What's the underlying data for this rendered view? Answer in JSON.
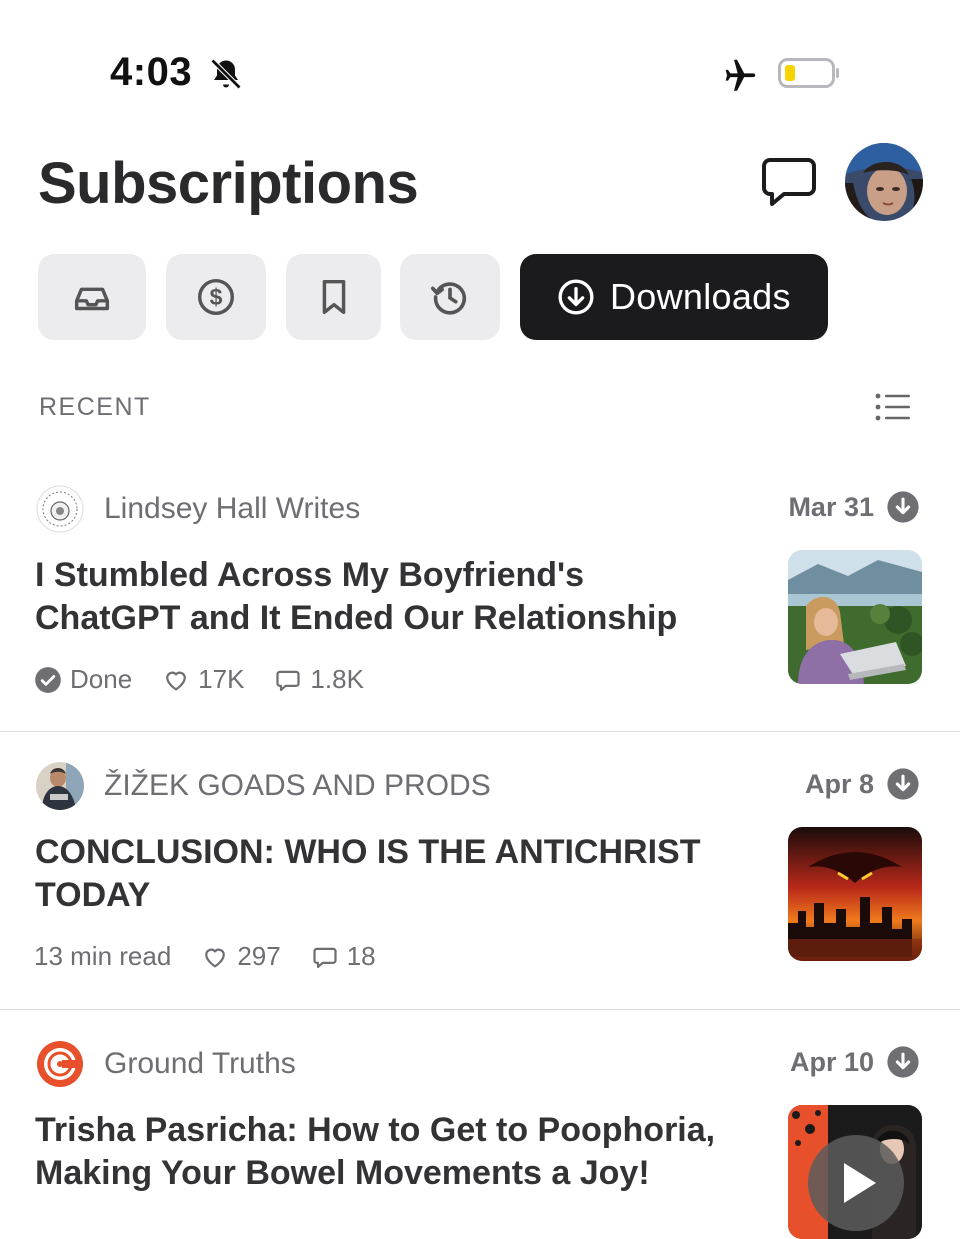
{
  "status_bar": {
    "time": "4:03"
  },
  "header": {
    "title": "Subscriptions"
  },
  "filters": {
    "downloads_label": "Downloads"
  },
  "section": {
    "label": "RECENT"
  },
  "posts": [
    {
      "publication": "Lindsey Hall Writes",
      "date": "Mar 31",
      "title": "I Stumbled Across My Boyfriend's ChatGPT and It Ended Our Relationship",
      "status": "Done",
      "likes": "17K",
      "comments": "1.8K"
    },
    {
      "publication": "ŽIŽEK GOADS AND PRODS",
      "date": "Apr 8",
      "title": "CONCLUSION: WHO IS THE ANTICHRIST TODAY",
      "read_time": "13 min read",
      "likes": "297",
      "comments": "18"
    },
    {
      "publication": "Ground Truths",
      "date": "Apr 10",
      "title": "Trisha Pasricha: How to Get to Poophoria, Making Your Bowel Movements a Joy!"
    }
  ],
  "colors": {
    "accent_dark": "#1b1b1d",
    "chip_bg": "#ececee",
    "battery_fill": "#f5d400",
    "brand_orange": "#e8502b"
  }
}
